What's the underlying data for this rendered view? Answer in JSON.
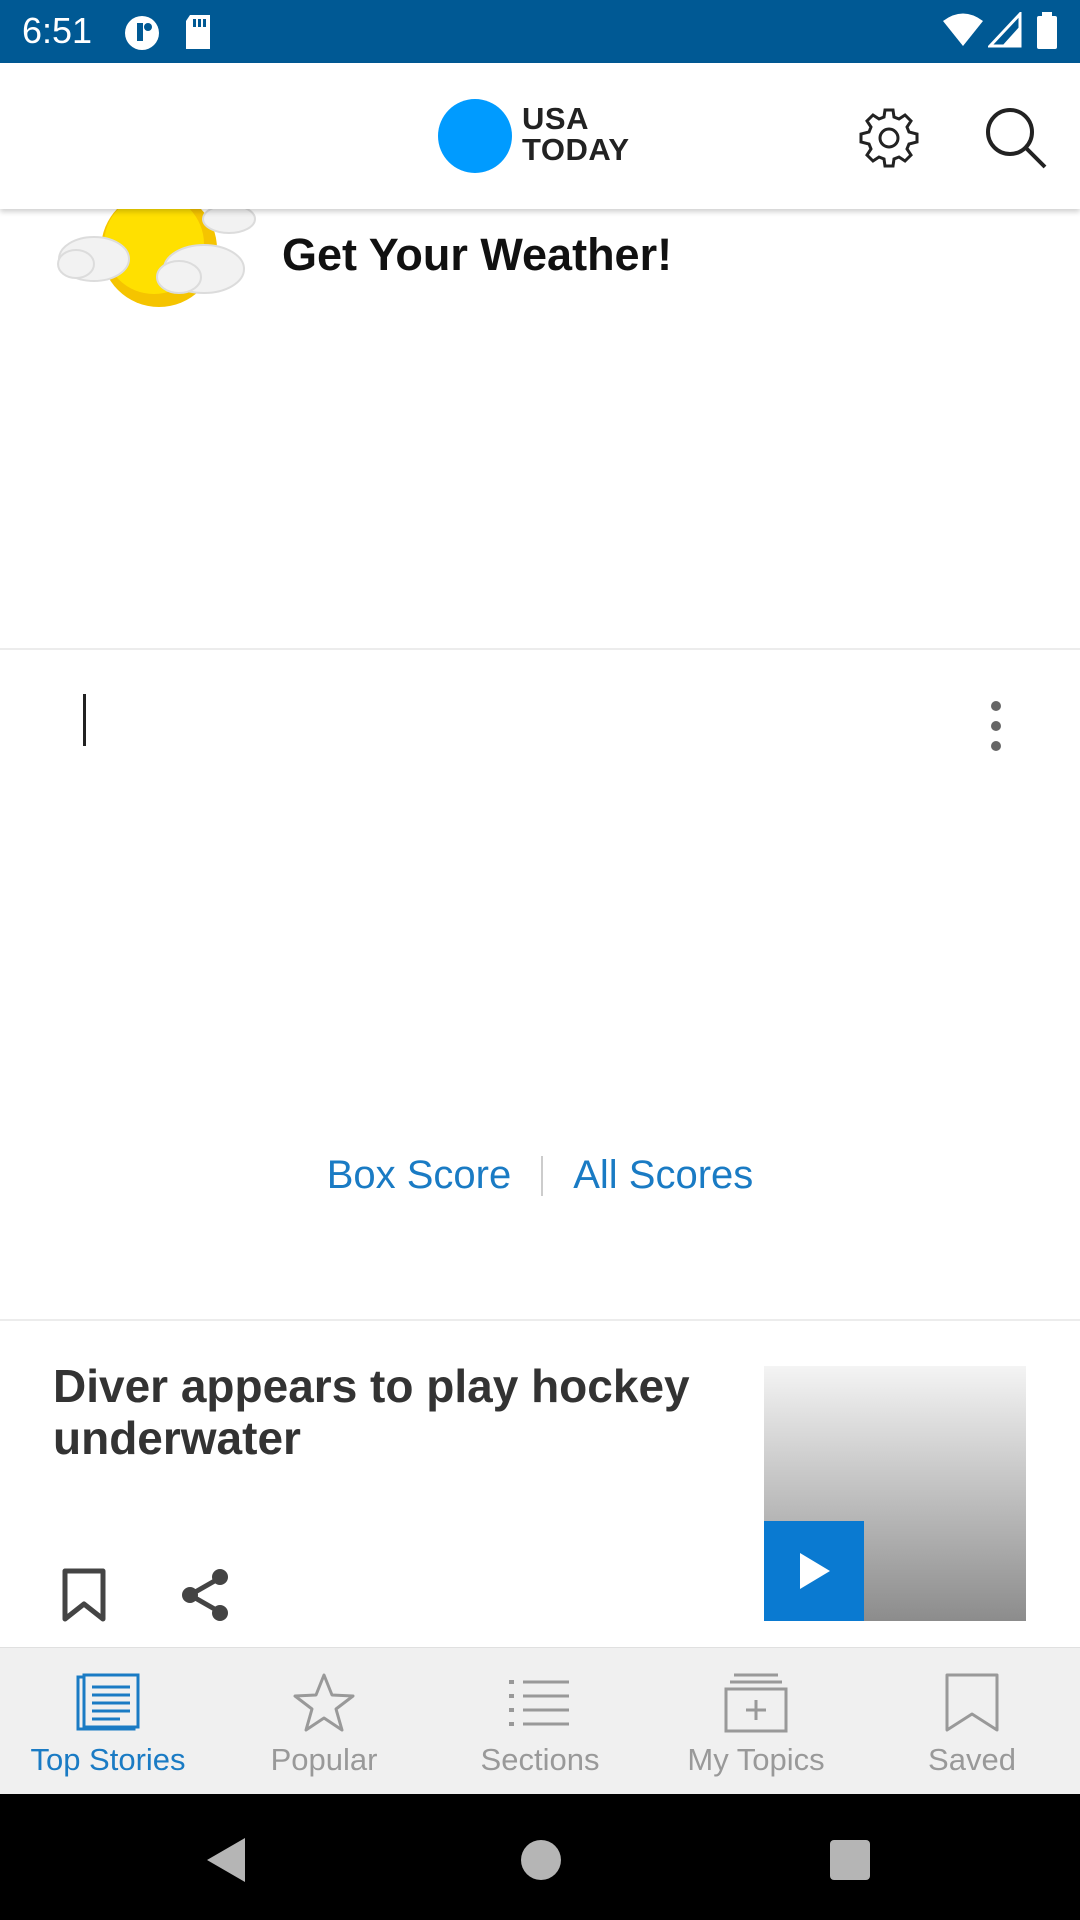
{
  "status_bar": {
    "time": "6:51"
  },
  "header": {
    "logo_line1": "USA",
    "logo_line2": "TODAY",
    "logo_color": "#009bff"
  },
  "weather": {
    "title": "Get Your Weather!"
  },
  "scores": {
    "box_score_label": "Box Score",
    "all_scores_label": "All Scores"
  },
  "story": {
    "title": "Diver appears to play hockey underwater"
  },
  "bottom_nav": {
    "items": [
      {
        "label": "Top Stories",
        "icon": "top-stories-icon",
        "active": true
      },
      {
        "label": "Popular",
        "icon": "star-icon"
      },
      {
        "label": "Sections",
        "icon": "list-icon"
      },
      {
        "label": "My Topics",
        "icon": "my-topics-icon"
      },
      {
        "label": "Saved",
        "icon": "bookmark-icon"
      }
    ]
  },
  "colors": {
    "status_bar": "#005994",
    "accent": "#1a7bc4",
    "play_button": "#0a7ad1"
  }
}
